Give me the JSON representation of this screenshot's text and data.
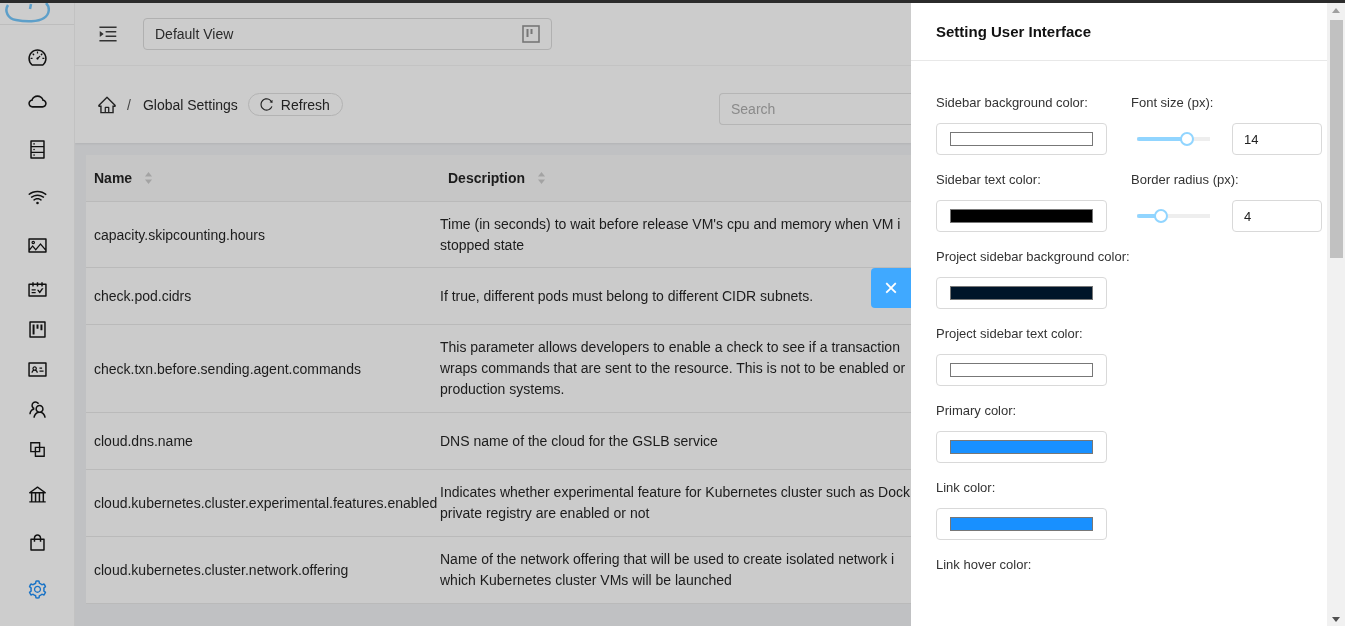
{
  "sidebar": {
    "nav_items": [
      {
        "selected": false
      },
      {
        "selected": false
      },
      {
        "selected": false
      },
      {
        "selected": false
      },
      {
        "selected": false
      },
      {
        "selected": false
      },
      {
        "selected": false
      },
      {
        "selected": false
      },
      {
        "selected": false
      },
      {
        "selected": false
      },
      {
        "selected": false
      },
      {
        "selected": false
      },
      {
        "selected": true
      }
    ]
  },
  "header": {
    "view_select": "Default View"
  },
  "breadcrumb": {
    "separator": "/",
    "current": "Global Settings",
    "refresh_button": "Refresh"
  },
  "search": {
    "placeholder": "Search"
  },
  "table": {
    "columns": [
      "Name",
      "Description"
    ],
    "rows": [
      {
        "name": "capacity.skipcounting.hours",
        "description": [
          "Time (in seconds) to wait before release VM's cpu and memory when VM i",
          "stopped state"
        ]
      },
      {
        "name": "check.pod.cidrs",
        "description": [
          "If true, different pods must belong to different CIDR subnets."
        ]
      },
      {
        "name": "check.txn.before.sending.agent.commands",
        "description": [
          "This parameter allows developers to enable a check to see if a transaction",
          "wraps commands that are sent to the resource. This is not to be enabled or",
          "production systems."
        ]
      },
      {
        "name": "cloud.dns.name",
        "description": [
          "DNS name of the cloud for the GSLB service"
        ]
      },
      {
        "name": "cloud.kubernetes.cluster.experimental.features.enabled",
        "description": [
          "Indicates whether experimental feature for Kubernetes cluster such as Dock",
          "private registry are enabled or not"
        ]
      },
      {
        "name": "cloud.kubernetes.cluster.network.offering",
        "description": [
          "Name of the network offering that will be used to create isolated network i",
          "which Kubernetes cluster VMs will be launched"
        ]
      }
    ]
  },
  "close_button": "×",
  "drawer": {
    "title": "Setting User Interface",
    "rows": [
      [
        {
          "kind": "color",
          "label": "Sidebar background color:",
          "color": "#ffffff"
        },
        {
          "kind": "slider",
          "label": "Font size (px):",
          "level": 0.68,
          "value": "14"
        }
      ],
      [
        {
          "kind": "color",
          "label": "Sidebar text color:",
          "color": "#000000"
        },
        {
          "kind": "slider",
          "label": "Border radius (px):",
          "level": 0.33,
          "value": "4"
        }
      ],
      [
        {
          "kind": "color",
          "label": "Project sidebar background color:",
          "color": "#001529"
        }
      ],
      [
        {
          "kind": "color",
          "label": "Project sidebar text color:",
          "color": "#ffffff"
        }
      ],
      [
        {
          "kind": "color",
          "label": "Primary color:",
          "color": "#1890ff"
        }
      ],
      [
        {
          "kind": "color",
          "label": "Link color:",
          "color": "#1890ff"
        }
      ],
      [
        {
          "kind": "heading",
          "label": "Link hover color:"
        }
      ]
    ]
  }
}
